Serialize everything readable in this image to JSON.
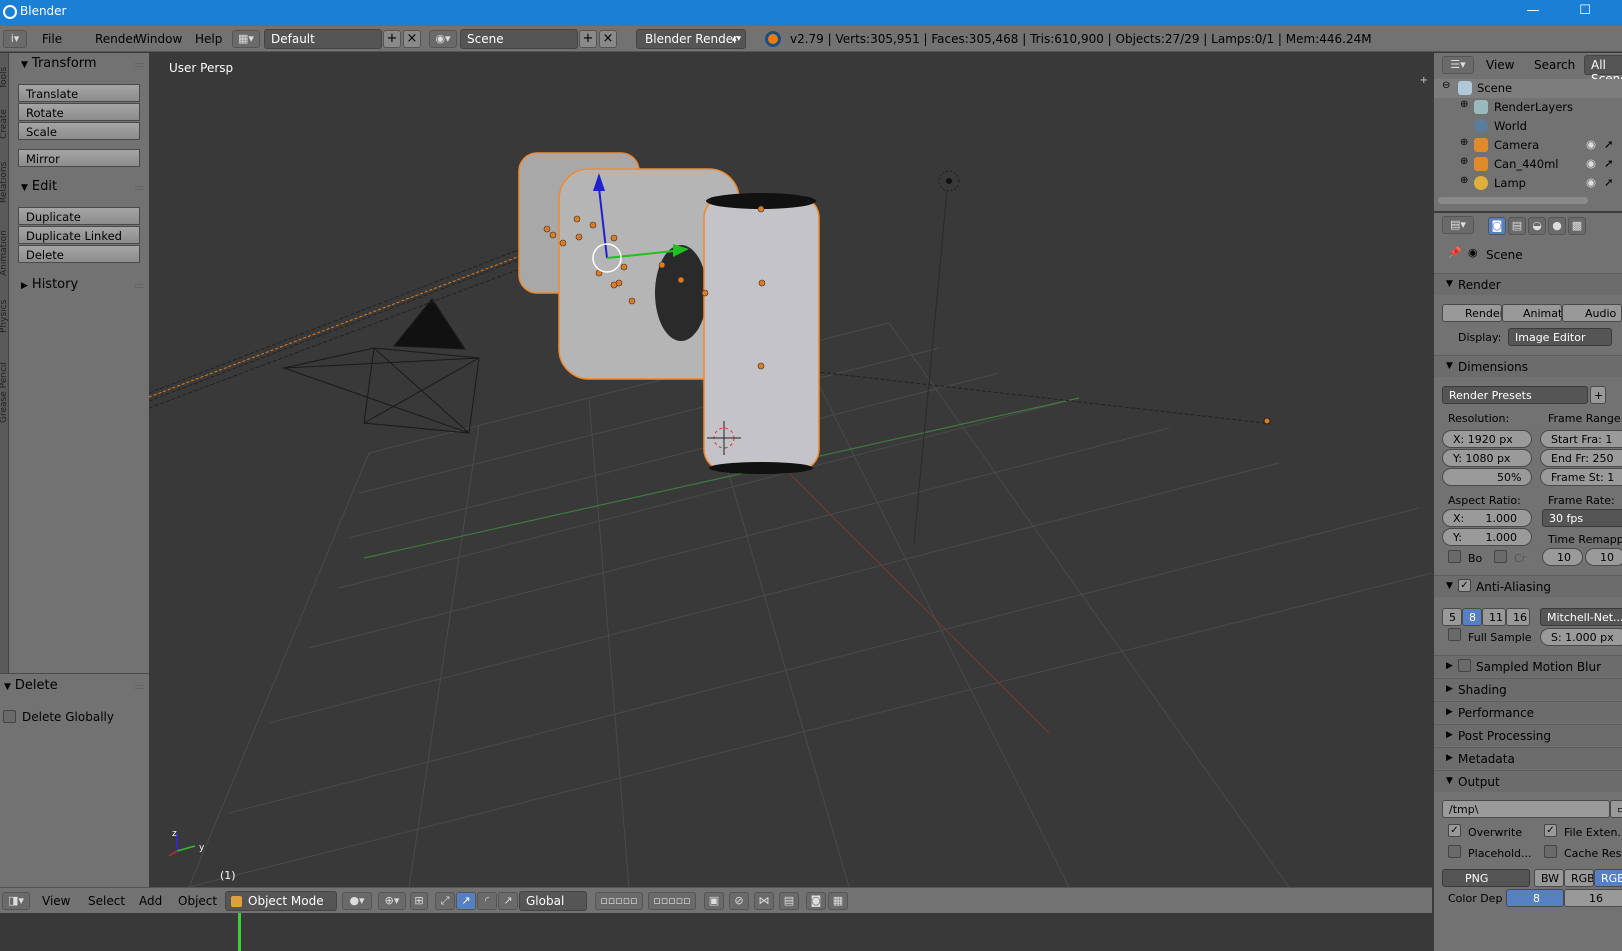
{
  "window": {
    "title": "Blender",
    "minimize": "—",
    "maximize": "☐"
  },
  "menubar": {
    "menus": [
      "File",
      "Render",
      "Window",
      "Help"
    ],
    "layout": "Default",
    "scene": "Scene",
    "engine": "Blender Render",
    "stats": "v2.79 | Verts:305,951 | Faces:305,468 | Tris:610,900 | Objects:27/29 | Lamps:0/1 | Mem:446.24M"
  },
  "tool_tabs": [
    "Tools",
    "Create",
    "Relations",
    "Animation",
    "Physics",
    "Grease Pencil"
  ],
  "toolshelf": {
    "transform_title": "Transform",
    "transform_buttons": [
      "Translate",
      "Rotate",
      "Scale"
    ],
    "mirror": "Mirror",
    "edit_title": "Edit",
    "edit_buttons": [
      "Duplicate",
      "Duplicate Linked",
      "Delete"
    ],
    "history_title": "History"
  },
  "last_operator": {
    "title": "Delete",
    "option": "Delete Globally"
  },
  "viewport": {
    "label": "User Persp",
    "frame": "(1)",
    "axis_x": "y",
    "axis_z": "z"
  },
  "view3d_header": {
    "menus": [
      "View",
      "Select",
      "Add",
      "Object"
    ],
    "mode": "Object Mode",
    "orientation": "Global"
  },
  "outliner": {
    "header": [
      "View",
      "Search",
      "All Scenes"
    ],
    "items": [
      "Scene",
      "RenderLayers",
      "World",
      "Camera",
      "Can_440ml",
      "Lamp"
    ]
  },
  "properties": {
    "context": "Scene",
    "render": {
      "title": "Render",
      "buttons": [
        "Render",
        "Animation",
        "Audio"
      ],
      "display_label": "Display:",
      "display_value": "Image Editor"
    },
    "dimensions": {
      "title": "Dimensions",
      "presets": "Render Presets",
      "resolution_label": "Resolution:",
      "res_x": "X: 1920 px",
      "res_y": "Y: 1080 px",
      "res_pct": "50%",
      "frame_range_label": "Frame Range:",
      "start": "Start Fra: 1",
      "end": "End Fr: 250",
      "step": "Frame St: 1",
      "aspect_label": "Aspect Ratio:",
      "asp_x": "X:",
      "asp_x_val": "1.000",
      "asp_y": "Y:",
      "asp_y_val": "1.000",
      "frame_rate_label": "Frame Rate:",
      "fps": "30 fps",
      "time_remap_label": "Time Remappi...",
      "remap_old": "10",
      "remap_new": "10",
      "border": "Bo",
      "crop": "Cr"
    },
    "anti_aliasing": {
      "title": "Anti-Aliasing",
      "samples": [
        "5",
        "8",
        "11",
        "16"
      ],
      "selected": "8",
      "filter": "Mitchell-Net...",
      "full_sample": "Full Sample",
      "size": "S: 1.000 px"
    },
    "collapsed_sections": [
      "Sampled Motion Blur",
      "Shading",
      "Performance",
      "Post Processing",
      "Metadata"
    ],
    "output": {
      "title": "Output",
      "path": "/tmp\\",
      "overwrite": "Overwrite",
      "file_extensions": "File Exten...",
      "placeholders": "Placehold...",
      "cache_result": "Cache Res...",
      "format": "PNG",
      "color_modes": [
        "BW",
        "RGB",
        "RGB"
      ],
      "color_depth_label": "Color Dep",
      "depths": [
        "8",
        "16"
      ]
    }
  },
  "colors": {
    "titlebar": "#1a80d6",
    "panel": "#727272",
    "viewport_bg": "#393939",
    "selection_outline": "#f08a30",
    "selected_button": "#5680c2"
  }
}
